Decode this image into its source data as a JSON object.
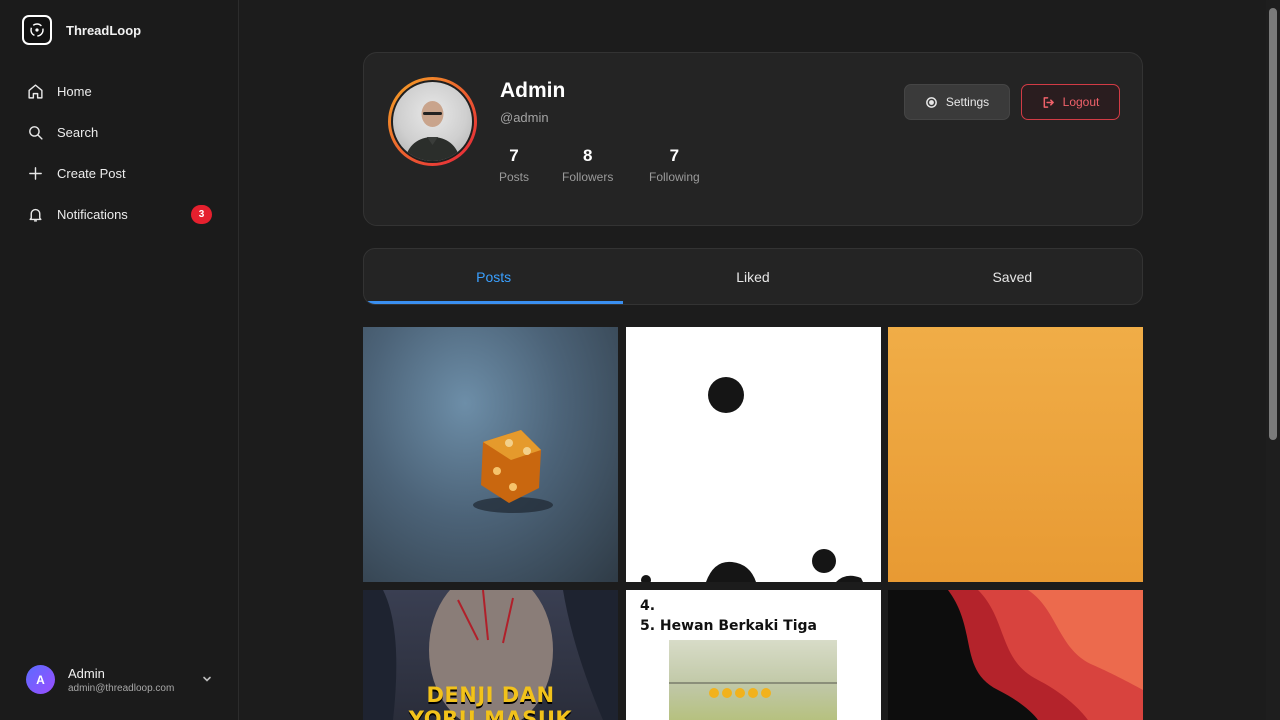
{
  "brand": {
    "name": "ThreadLoop",
    "icon": "threadloop-logo"
  },
  "nav": {
    "items": [
      {
        "label": "Home",
        "icon": "home-icon"
      },
      {
        "label": "Search",
        "icon": "search-icon"
      },
      {
        "label": "Create Post",
        "icon": "plus-icon"
      },
      {
        "label": "Notifications",
        "icon": "bell-icon",
        "badge": "3"
      }
    ]
  },
  "user": {
    "initial": "A",
    "name": "Admin",
    "email": "admin@threadloop.com"
  },
  "profile": {
    "name": "Admin",
    "handle": "@admin",
    "stats": [
      {
        "value": "7",
        "label": "Posts"
      },
      {
        "value": "8",
        "label": "Followers"
      },
      {
        "value": "7",
        "label": "Following"
      }
    ],
    "settings_label": "Settings",
    "logout_label": "Logout"
  },
  "tabs": [
    {
      "label": "Posts",
      "active": true
    },
    {
      "label": "Liked",
      "active": false
    },
    {
      "label": "Saved",
      "active": false
    }
  ],
  "posts": {
    "tile5_text_line1": "4.",
    "tile5_text_line2": "5. Hewan Berkaki Tiga",
    "tile4_caption_line1": "DENJI DAN",
    "tile4_caption_line2": "YORU MASUK"
  },
  "colors": {
    "accent": "#3aa0ff",
    "danger": "#d23b45",
    "badge": "#e5202e"
  }
}
